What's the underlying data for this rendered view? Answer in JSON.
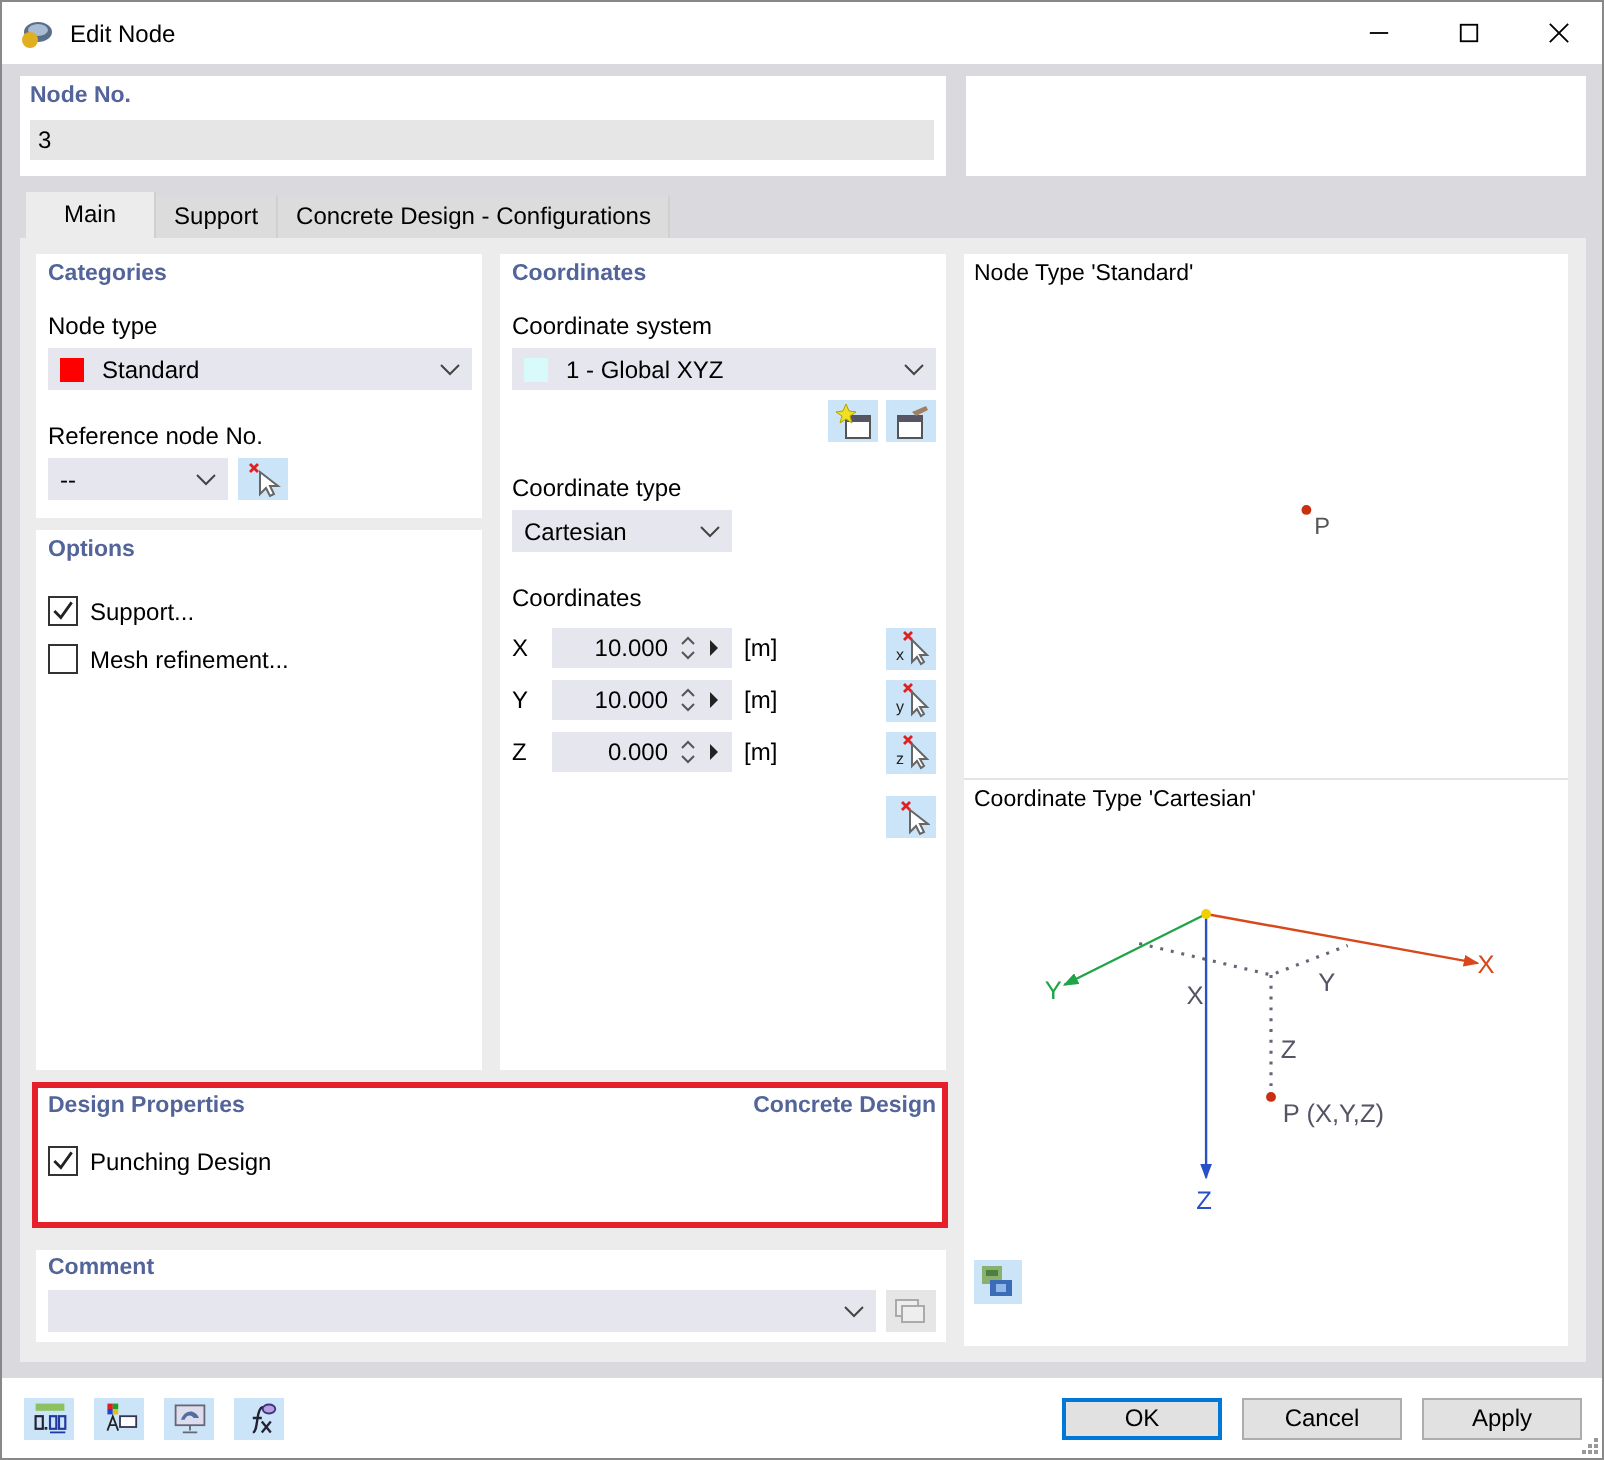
{
  "window": {
    "title": "Edit Node"
  },
  "node_no": {
    "label": "Node No.",
    "value": "3"
  },
  "tabs": [
    {
      "label": "Main",
      "selected": true
    },
    {
      "label": "Support",
      "selected": false
    },
    {
      "label": "Concrete Design - Configurations",
      "selected": false
    }
  ],
  "categories": {
    "title": "Categories",
    "node_type": {
      "label": "Node type",
      "value": "Standard",
      "color": "#ff0000"
    },
    "reference_node": {
      "label": "Reference node No.",
      "value": "--"
    }
  },
  "options": {
    "title": "Options",
    "items": [
      {
        "label": "Support...",
        "checked": true
      },
      {
        "label": "Mesh refinement...",
        "checked": false
      }
    ]
  },
  "coordinates": {
    "title": "Coordinates",
    "system": {
      "label": "Coordinate system",
      "value": "1 - Global XYZ",
      "color": "#d9fafa"
    },
    "type": {
      "label": "Coordinate type",
      "value": "Cartesian"
    },
    "values_label": "Coordinates",
    "rows": [
      {
        "axis": "X",
        "value": "10.000",
        "unit": "[m]",
        "pick": "x"
      },
      {
        "axis": "Y",
        "value": "10.000",
        "unit": "[m]",
        "pick": "y"
      },
      {
        "axis": "Z",
        "value": "0.000",
        "unit": "[m]",
        "pick": "z"
      }
    ]
  },
  "node_type_preview": {
    "title": "Node Type 'Standard'",
    "point_label": "P"
  },
  "coordinate_type_preview": {
    "title": "Coordinate Type 'Cartesian'",
    "axes": [
      {
        "label": "X",
        "color": "#d9481a"
      },
      {
        "label": "Y",
        "color": "#1fa447"
      },
      {
        "label": "Z",
        "color": "#2850c8"
      }
    ],
    "component_labels": [
      "X",
      "Y",
      "Z"
    ],
    "point_label": "P (X,Y,Z)"
  },
  "design_properties": {
    "title": "Design Properties",
    "addon": "Concrete Design",
    "items": [
      {
        "label": "Punching Design",
        "checked": true
      }
    ]
  },
  "comment": {
    "label": "Comment"
  },
  "buttons": [
    {
      "label": "OK",
      "default": true
    },
    {
      "label": "Cancel",
      "default": false
    },
    {
      "label": "Apply",
      "default": false
    }
  ]
}
